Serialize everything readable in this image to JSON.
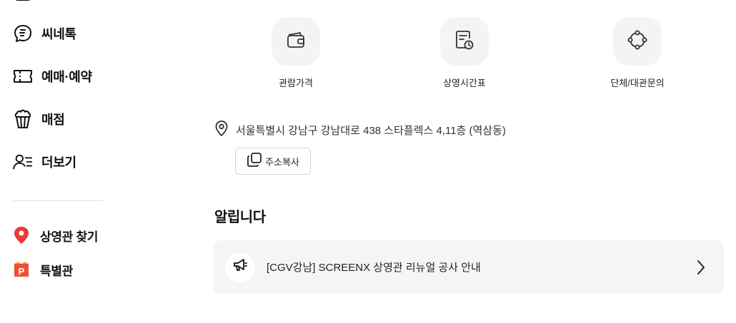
{
  "sidebar": {
    "items": [
      {
        "label": "씨네톡",
        "icon": "chat-bubble-icon"
      },
      {
        "label": "예매·예약",
        "icon": "ticket-icon"
      },
      {
        "label": "매점",
        "icon": "popcorn-icon"
      },
      {
        "label": "더보기",
        "icon": "user-menu-icon"
      }
    ],
    "sub_items": [
      {
        "label": "상영관 찾기",
        "icon": "location-pin-icon",
        "color": "#e83a3a"
      },
      {
        "label": "특별관",
        "icon": "special-theater-icon",
        "color": "#f04e37"
      }
    ]
  },
  "quick_menu": [
    {
      "label": "관람가격",
      "icon": "wallet-icon"
    },
    {
      "label": "상영시간표",
      "icon": "schedule-icon"
    },
    {
      "label": "단체/대관문의",
      "icon": "group-icon"
    }
  ],
  "address": {
    "text": "서울특별시 강남구 강남대로 438 스타플렉스 4,11층 (역삼동)",
    "copy_label": "주소복사"
  },
  "notices": {
    "title": "알립니다",
    "items": [
      {
        "text": "[CGV강남] SCREENX 상영관 리뉴얼 공사 안내",
        "icon": "megaphone-icon"
      }
    ]
  }
}
